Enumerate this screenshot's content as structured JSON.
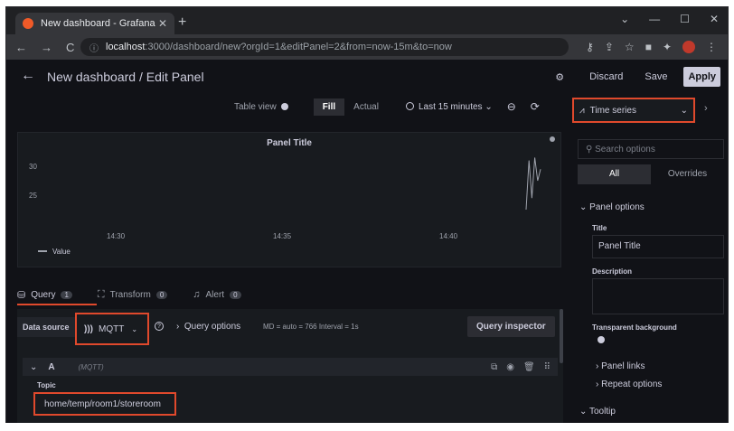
{
  "browser": {
    "tab_title": "New dashboard - Grafana",
    "url_host": "localhost",
    "url_rest": ":3000/dashboard/new?orgId=1&editPanel=2&from=now-15m&to=now"
  },
  "header": {
    "title": "New dashboard / Edit Panel",
    "discard": "Discard",
    "save": "Save",
    "apply": "Apply"
  },
  "toolbar": {
    "table_view": "Table view",
    "fill": "Fill",
    "actual": "Actual",
    "time_range": "Last 15 minutes"
  },
  "visualization": {
    "selected": "Time series"
  },
  "panel": {
    "title": "Panel Title",
    "legend": "Value"
  },
  "chart_data": {
    "type": "line",
    "y_ticks": [
      "30",
      "25"
    ],
    "x_ticks": [
      "14:30",
      "14:35",
      "14:40"
    ],
    "series": [
      {
        "name": "Value",
        "color": "#9fa3ad",
        "points": [
          [
            0.0,
            22.5
          ],
          [
            0.4,
            31.0
          ],
          [
            0.8,
            24.5
          ],
          [
            1.2,
            31.5
          ],
          [
            1.6,
            27.5
          ],
          [
            2.0,
            29.5
          ]
        ]
      }
    ]
  },
  "query": {
    "tabs": [
      {
        "label": "Query",
        "count": "1"
      },
      {
        "label": "Transform",
        "count": "0"
      },
      {
        "label": "Alert",
        "count": "0"
      }
    ],
    "data_source_label": "Data source",
    "data_source": "MQTT",
    "query_options": "Query options",
    "query_meta": "MD = auto = 766   Interval = 1s",
    "inspector": "Query inspector",
    "row_letter": "A",
    "row_ds": "(MQTT)",
    "topic_label": "Topic",
    "topic_value": "home/temp/room1/storeroom"
  },
  "options": {
    "search_placeholder": "Search options",
    "tab_all": "All",
    "tab_overrides": "Overrides",
    "panel_options": "Panel options",
    "title_label": "Title",
    "title_value": "Panel Title",
    "description_label": "Description",
    "transparent_label": "Transparent background",
    "panel_links": "Panel links",
    "repeat_options": "Repeat options",
    "tooltip": "Tooltip"
  }
}
